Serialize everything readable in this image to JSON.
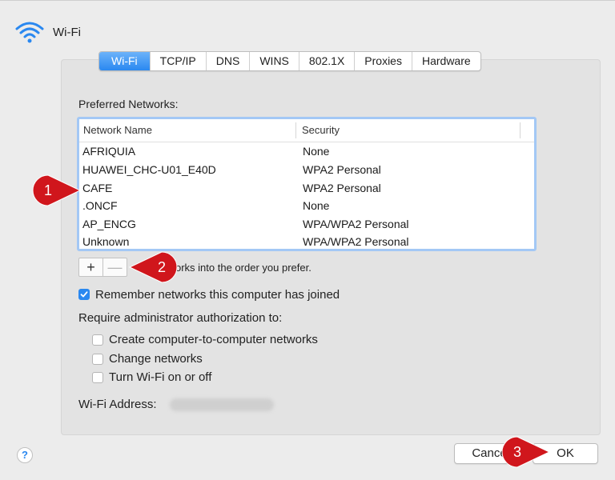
{
  "header": {
    "title": "Wi-Fi",
    "icon": "wifi-icon"
  },
  "tabs": [
    {
      "label": "Wi-Fi",
      "active": true
    },
    {
      "label": "TCP/IP",
      "active": false
    },
    {
      "label": "DNS",
      "active": false
    },
    {
      "label": "WINS",
      "active": false
    },
    {
      "label": "802.1X",
      "active": false
    },
    {
      "label": "Proxies",
      "active": false
    },
    {
      "label": "Hardware",
      "active": false
    }
  ],
  "preferred_networks": {
    "label": "Preferred Networks:",
    "columns": [
      "Network Name",
      "Security"
    ],
    "rows": [
      {
        "name": "AFRIQUIA",
        "security": "None"
      },
      {
        "name": "HUAWEI_CHC-U01_E40D",
        "security": "WPA2 Personal"
      },
      {
        "name": "CAFE",
        "security": "WPA2 Personal"
      },
      {
        "name": ".ONCF",
        "security": "None"
      },
      {
        "name": "AP_ENCG",
        "security": "WPA/WPA2 Personal"
      },
      {
        "name": "Unknown",
        "security": "WPA/WPA2 Personal"
      }
    ]
  },
  "controls": {
    "add": "+",
    "remove": "—",
    "hint": "tworks into the order you prefer."
  },
  "remember": {
    "label": "Remember networks this computer has joined",
    "checked": true
  },
  "admin": {
    "label": "Require administrator authorization to:",
    "options": [
      {
        "label": "Create computer-to-computer networks",
        "checked": false
      },
      {
        "label": "Change networks",
        "checked": false
      },
      {
        "label": "Turn Wi-Fi on or off",
        "checked": false
      }
    ]
  },
  "address": {
    "label": "Wi-Fi Address:"
  },
  "footer": {
    "help": "?",
    "cancel": "Cance",
    "ok": "OK"
  },
  "markers": [
    "1",
    "2",
    "3"
  ],
  "colors": {
    "accent": "#2a88f0",
    "marker": "#d0161c",
    "table_focus": "#a3c8f5"
  }
}
